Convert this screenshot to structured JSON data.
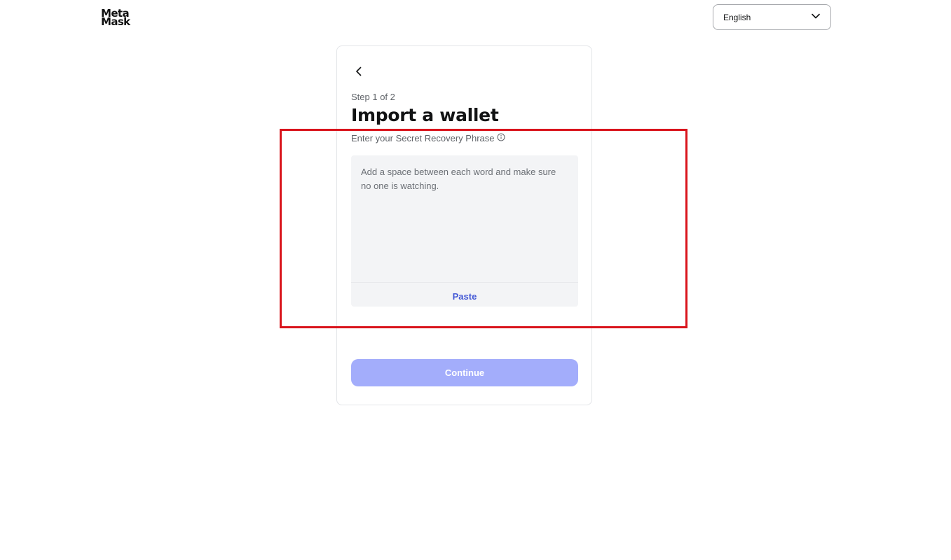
{
  "logo": {
    "line1": "Meta",
    "line2": "Mask"
  },
  "language_select": {
    "value": "English",
    "icon": "chevron-down-icon"
  },
  "card": {
    "back_icon": "chevron-left-icon",
    "step": "Step 1 of 2",
    "title": "Import a wallet",
    "srp_label": "Enter your Secret Recovery Phrase",
    "info_icon": "info-icon",
    "srp_placeholder": "Add a space between each word and make sure no one is watching.",
    "srp_value": "",
    "paste_label": "Paste",
    "continue_label": "Continue"
  },
  "colors": {
    "primary": "#4459d6",
    "continue_disabled": "#a3adfb",
    "highlight": "#d9141c",
    "input_bg": "#f3f4f6"
  }
}
